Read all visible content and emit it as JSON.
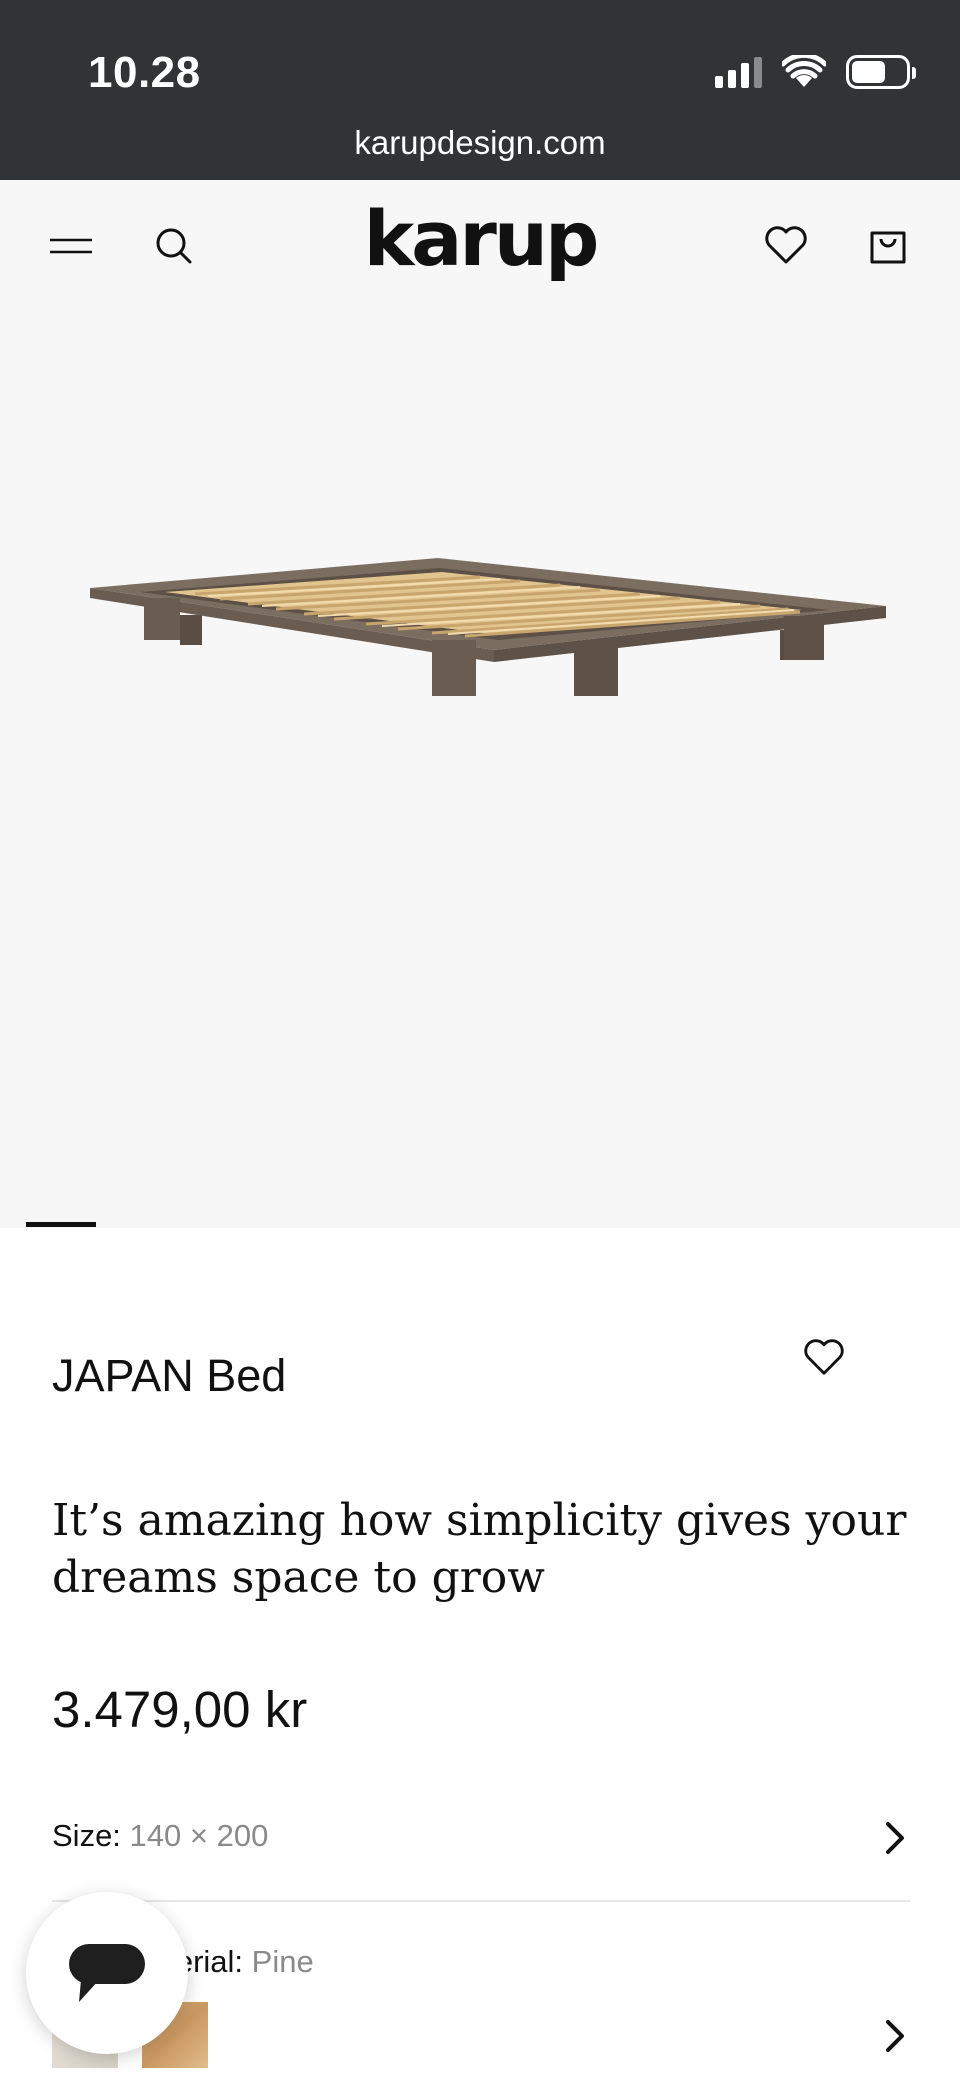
{
  "status_bar": {
    "time": "10.28",
    "url": "karupdesign.com",
    "battery_level": 0.64
  },
  "header": {
    "logo": "karup",
    "menu_icon": "hamburger-menu-icon",
    "search_icon": "search-icon",
    "wishlist_icon": "heart-icon",
    "cart_icon": "shopping-bag-icon"
  },
  "gallery": {
    "image_alt": "JAPAN Bed",
    "current_slide": 1
  },
  "product": {
    "title": "JAPAN Bed",
    "tagline": "It’s amazing how simplicity gives your dreams space to grow",
    "price": "3.479,00 kr",
    "wishlist_icon": "heart-icon"
  },
  "options": {
    "size": {
      "label": "Size:",
      "value": "140 × 200"
    },
    "material": {
      "label": "Material:",
      "visible_label": "aterial:",
      "value": "Pine",
      "swatches": [
        "white",
        "pine"
      ]
    }
  },
  "chat": {
    "icon": "chat-bubble-icon"
  }
}
